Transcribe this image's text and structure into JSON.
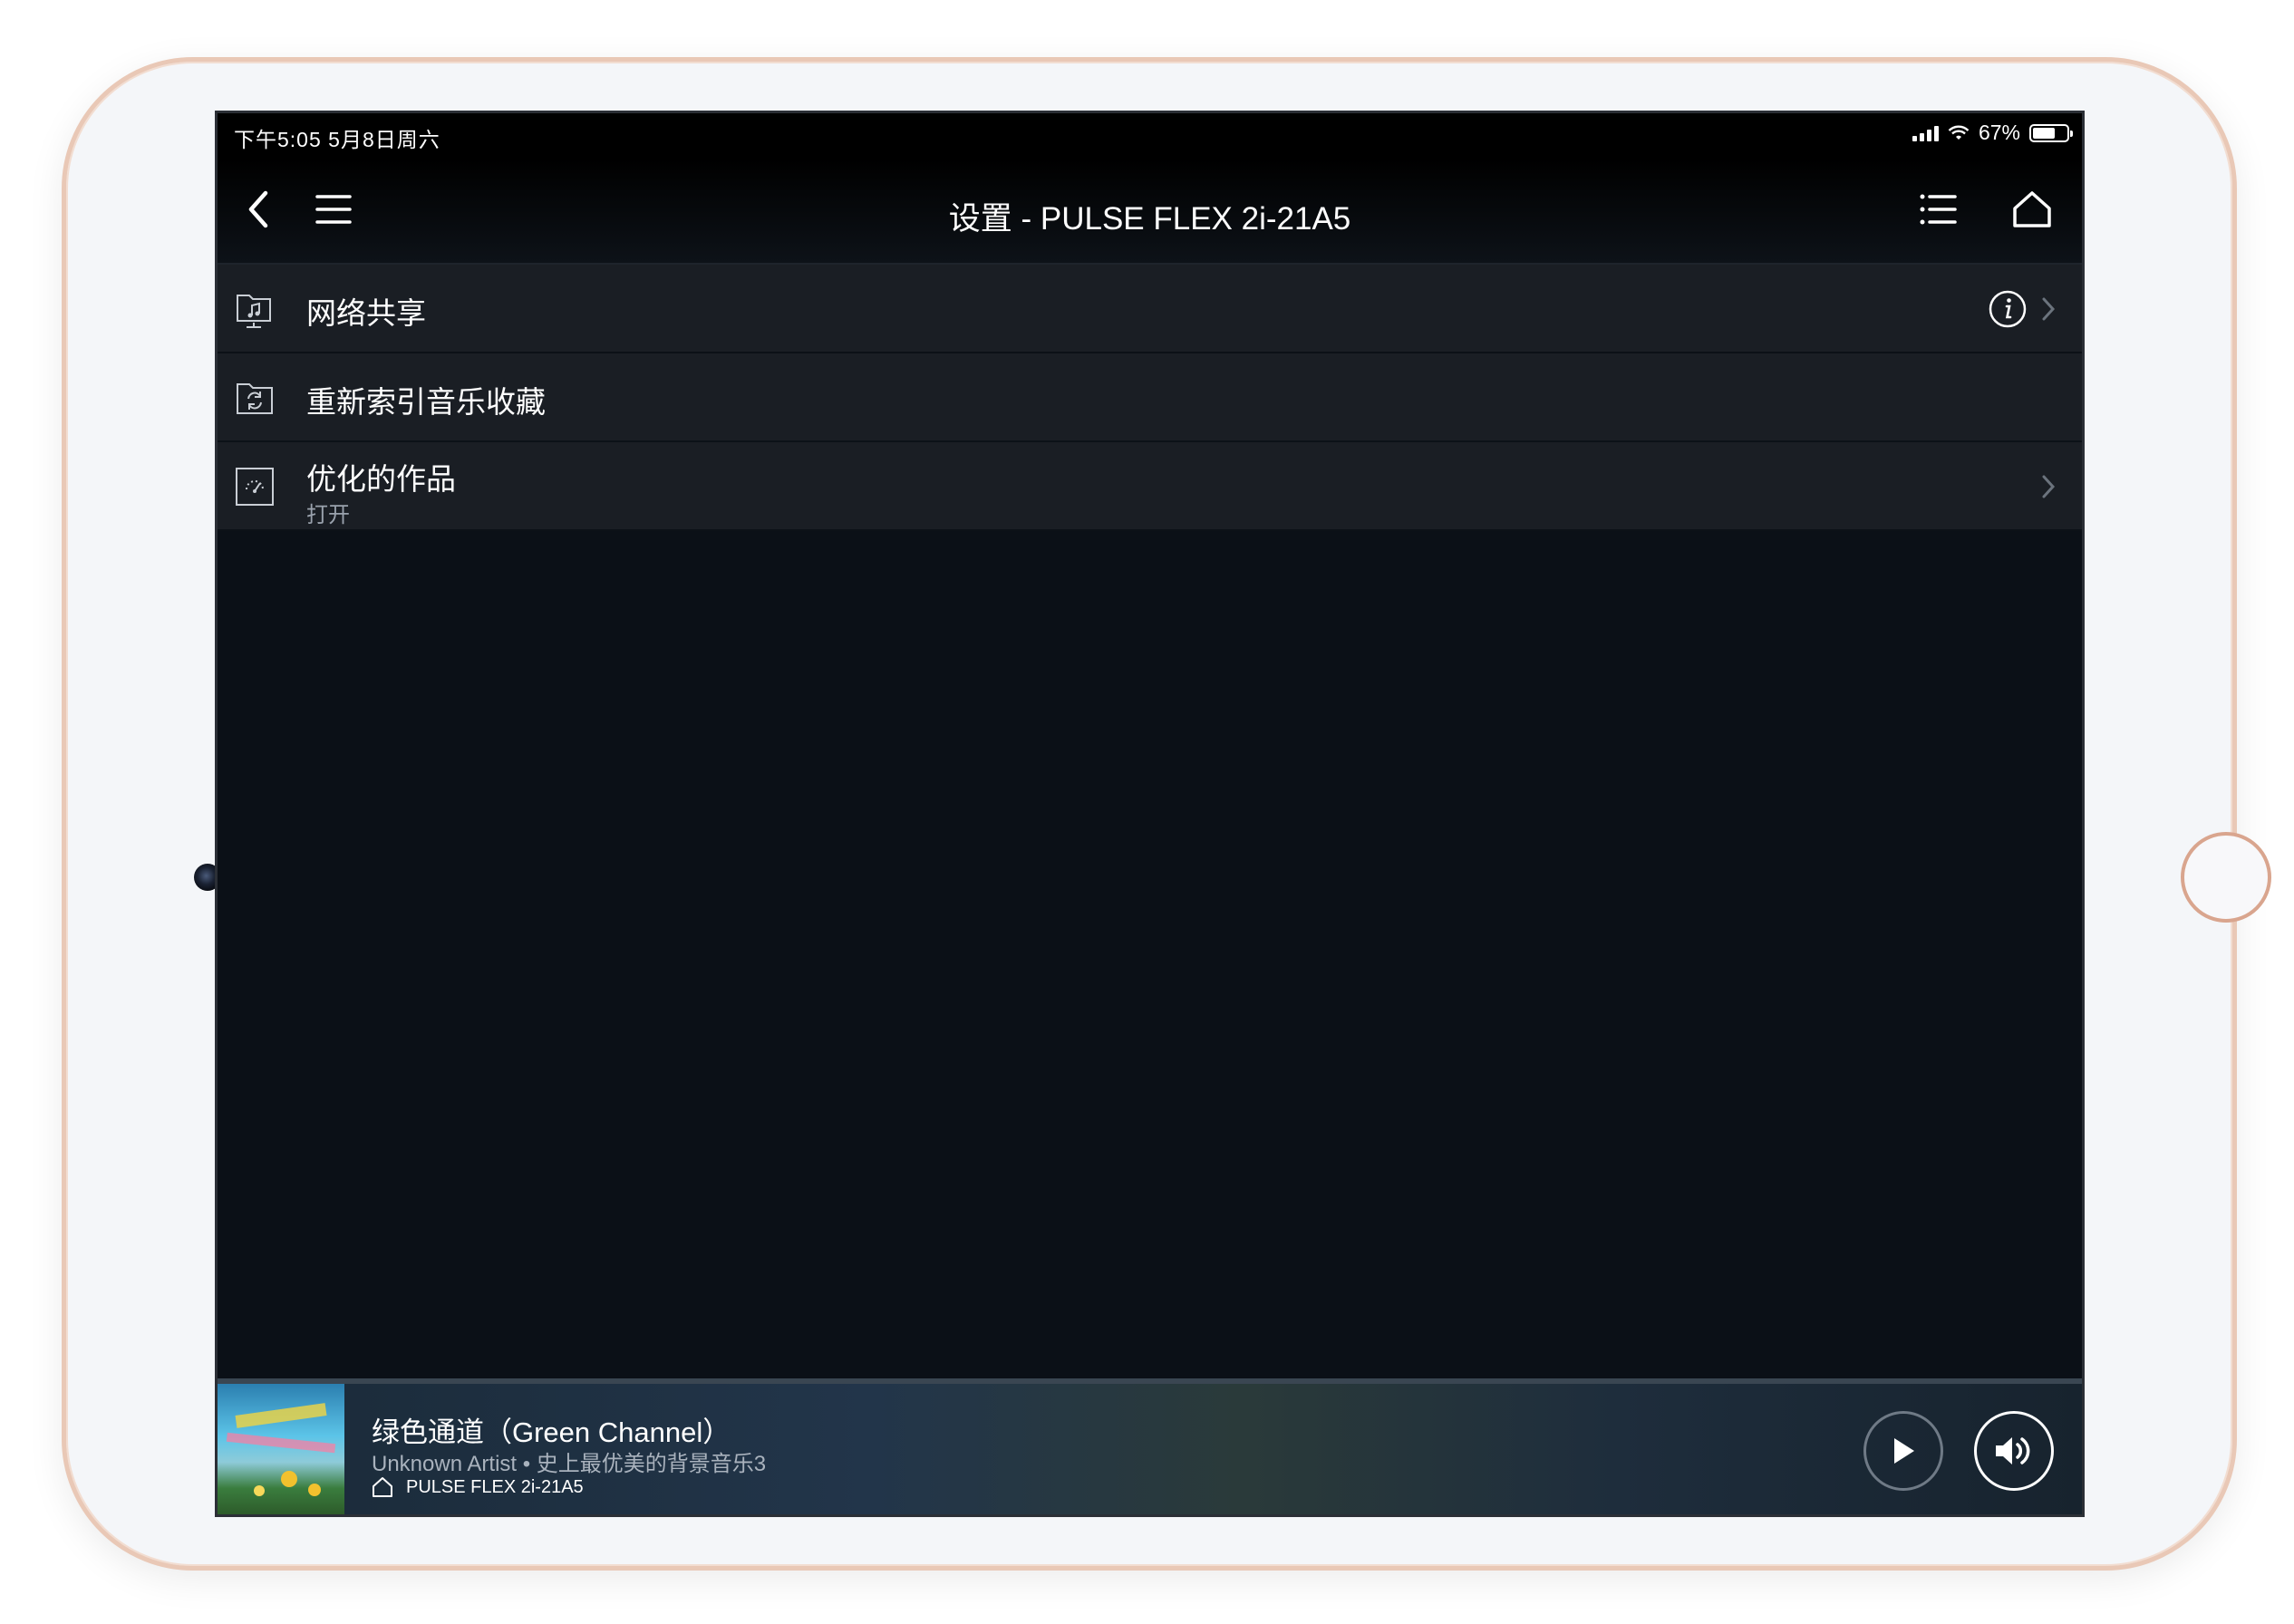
{
  "status_bar": {
    "time_date": "下午5:05   5月8日周六",
    "battery_text": "67%",
    "battery_level": 0.67
  },
  "nav": {
    "title": "设置 - PULSE FLEX 2i-21A5",
    "back_icon": "chevron-left-icon",
    "menu_icon": "hamburger-icon",
    "queue_icon": "list-icon",
    "home_icon": "home-icon"
  },
  "settings": {
    "items": [
      {
        "title": "网络共享",
        "subtitle": "",
        "icon": "folder-music-icon",
        "has_info": true,
        "has_chevron": true
      },
      {
        "title": "重新索引音乐收藏",
        "subtitle": "",
        "icon": "folder-refresh-icon",
        "has_info": false,
        "has_chevron": false
      },
      {
        "title": "优化的作品",
        "subtitle": "打开",
        "icon": "gauge-icon",
        "has_info": false,
        "has_chevron": true
      }
    ]
  },
  "now_playing": {
    "title": "绿色通道（Green Channel）",
    "artist_album": "Unknown Artist • 史上最优美的背景音乐3",
    "room": "PULSE FLEX 2i-21A5",
    "play_icon": "play-icon",
    "volume_icon": "speaker-volume-icon"
  },
  "colors": {
    "screen_bg": "#0b1017",
    "row_bg": "#1a1e24",
    "device_border": "#e9c8b6"
  }
}
